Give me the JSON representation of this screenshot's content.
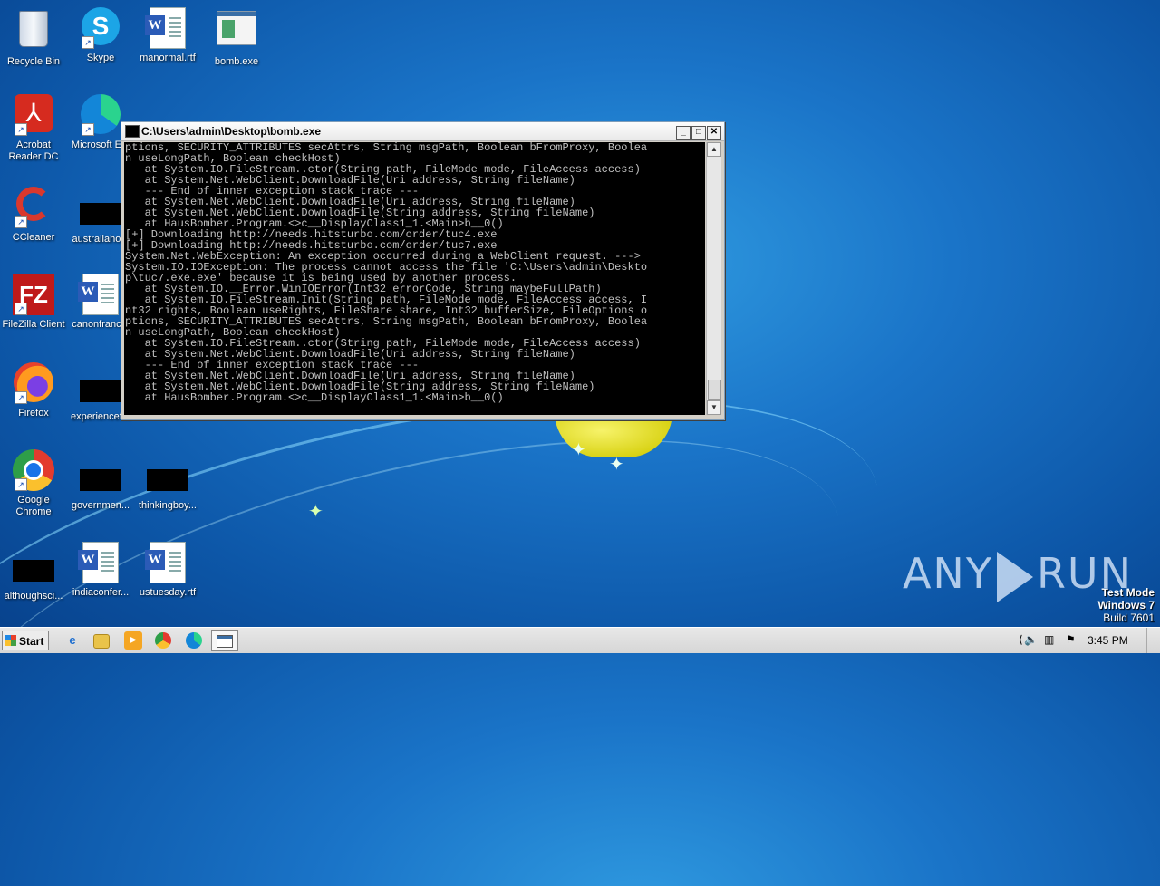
{
  "desktop": {
    "icons": [
      {
        "label": "Recycle Bin"
      },
      {
        "label": "Skype"
      },
      {
        "label": "manormal.rtf"
      },
      {
        "label": "bomb.exe"
      },
      {
        "label": "Acrobat Reader DC"
      },
      {
        "label": "Microsoft E..."
      },
      {
        "label": "CCleaner"
      },
      {
        "label": "australiaho..."
      },
      {
        "label": "FileZilla Client"
      },
      {
        "label": "canonfranc..."
      },
      {
        "label": "Firefox"
      },
      {
        "label": "experiencef..."
      },
      {
        "label": "Google Chrome"
      },
      {
        "label": "governmen..."
      },
      {
        "label": "thinkingboy..."
      },
      {
        "label": "althoughsci..."
      },
      {
        "label": "indiaconfer..."
      },
      {
        "label": "ustuesday.rtf"
      }
    ]
  },
  "console_window": {
    "title": "C:\\Users\\admin\\Desktop\\bomb.exe",
    "minimize_label": "_",
    "maximize_label": "□",
    "close_label": "✕",
    "output": "ptions, SECURITY_ATTRIBUTES secAttrs, String msgPath, Boolean bFromProxy, Boolea\nn useLongPath, Boolean checkHost)\n   at System.IO.FileStream..ctor(String path, FileMode mode, FileAccess access)\n   at System.Net.WebClient.DownloadFile(Uri address, String fileName)\n   --- End of inner exception stack trace ---\n   at System.Net.WebClient.DownloadFile(Uri address, String fileName)\n   at System.Net.WebClient.DownloadFile(String address, String fileName)\n   at HausBomber.Program.<>c__DisplayClass1_1.<Main>b__0()\n[+] Downloading http://needs.hitsturbo.com/order/tuc4.exe\n[+] Downloading http://needs.hitsturbo.com/order/tuc7.exe\nSystem.Net.WebException: An exception occurred during a WebClient request. --->\nSystem.IO.IOException: The process cannot access the file 'C:\\Users\\admin\\Deskto\np\\tuc7.exe.exe' because it is being used by another process.\n   at System.IO.__Error.WinIOError(Int32 errorCode, String maybeFullPath)\n   at System.IO.FileStream.Init(String path, FileMode mode, FileAccess access, I\nnt32 rights, Boolean useRights, FileShare share, Int32 bufferSize, FileOptions o\nptions, SECURITY_ATTRIBUTES secAttrs, String msgPath, Boolean bFromProxy, Boolea\nn useLongPath, Boolean checkHost)\n   at System.IO.FileStream..ctor(String path, FileMode mode, FileAccess access)\n   at System.Net.WebClient.DownloadFile(Uri address, String fileName)\n   --- End of inner exception stack trace ---\n   at System.Net.WebClient.DownloadFile(Uri address, String fileName)\n   at System.Net.WebClient.DownloadFile(String address, String fileName)\n   at HausBomber.Program.<>c__DisplayClass1_1.<Main>b__0()"
  },
  "taskbar": {
    "start_label": "Start",
    "clock": "3:45 PM"
  },
  "watermark": {
    "any": "ANY",
    "run": "RUN"
  },
  "test_mode": {
    "line1": "Test Mode",
    "line2": "Windows 7",
    "line3": "Build 7601"
  }
}
